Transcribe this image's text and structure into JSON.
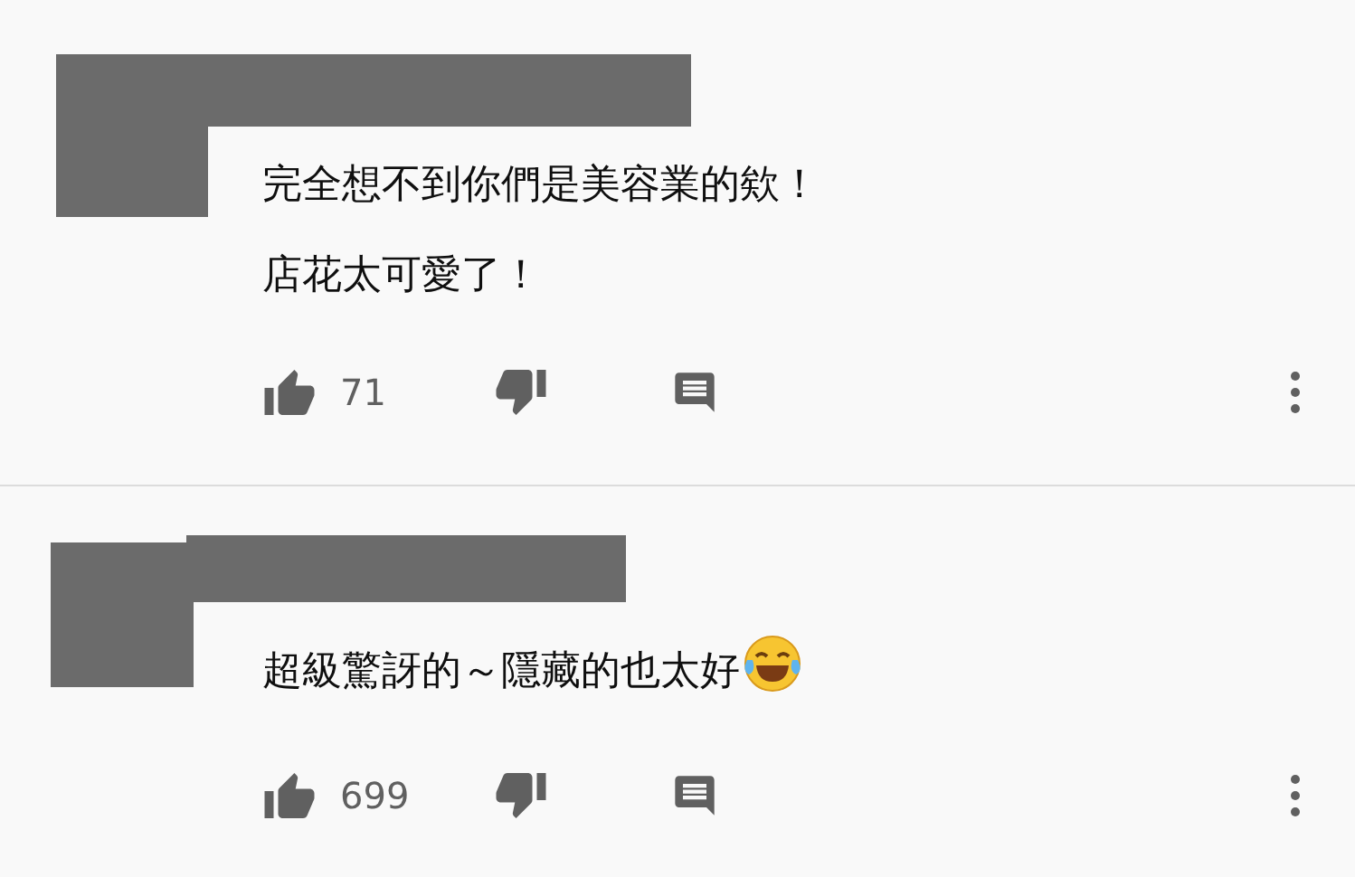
{
  "comments": [
    {
      "lines": [
        "完全想不到你們是美容業的欸！",
        "店花太可愛了！"
      ],
      "likes": "71",
      "trailing_emoji": false
    },
    {
      "lines": [
        "超級驚訝的～隱藏的也太好"
      ],
      "likes": "699",
      "trailing_emoji": true
    }
  ]
}
